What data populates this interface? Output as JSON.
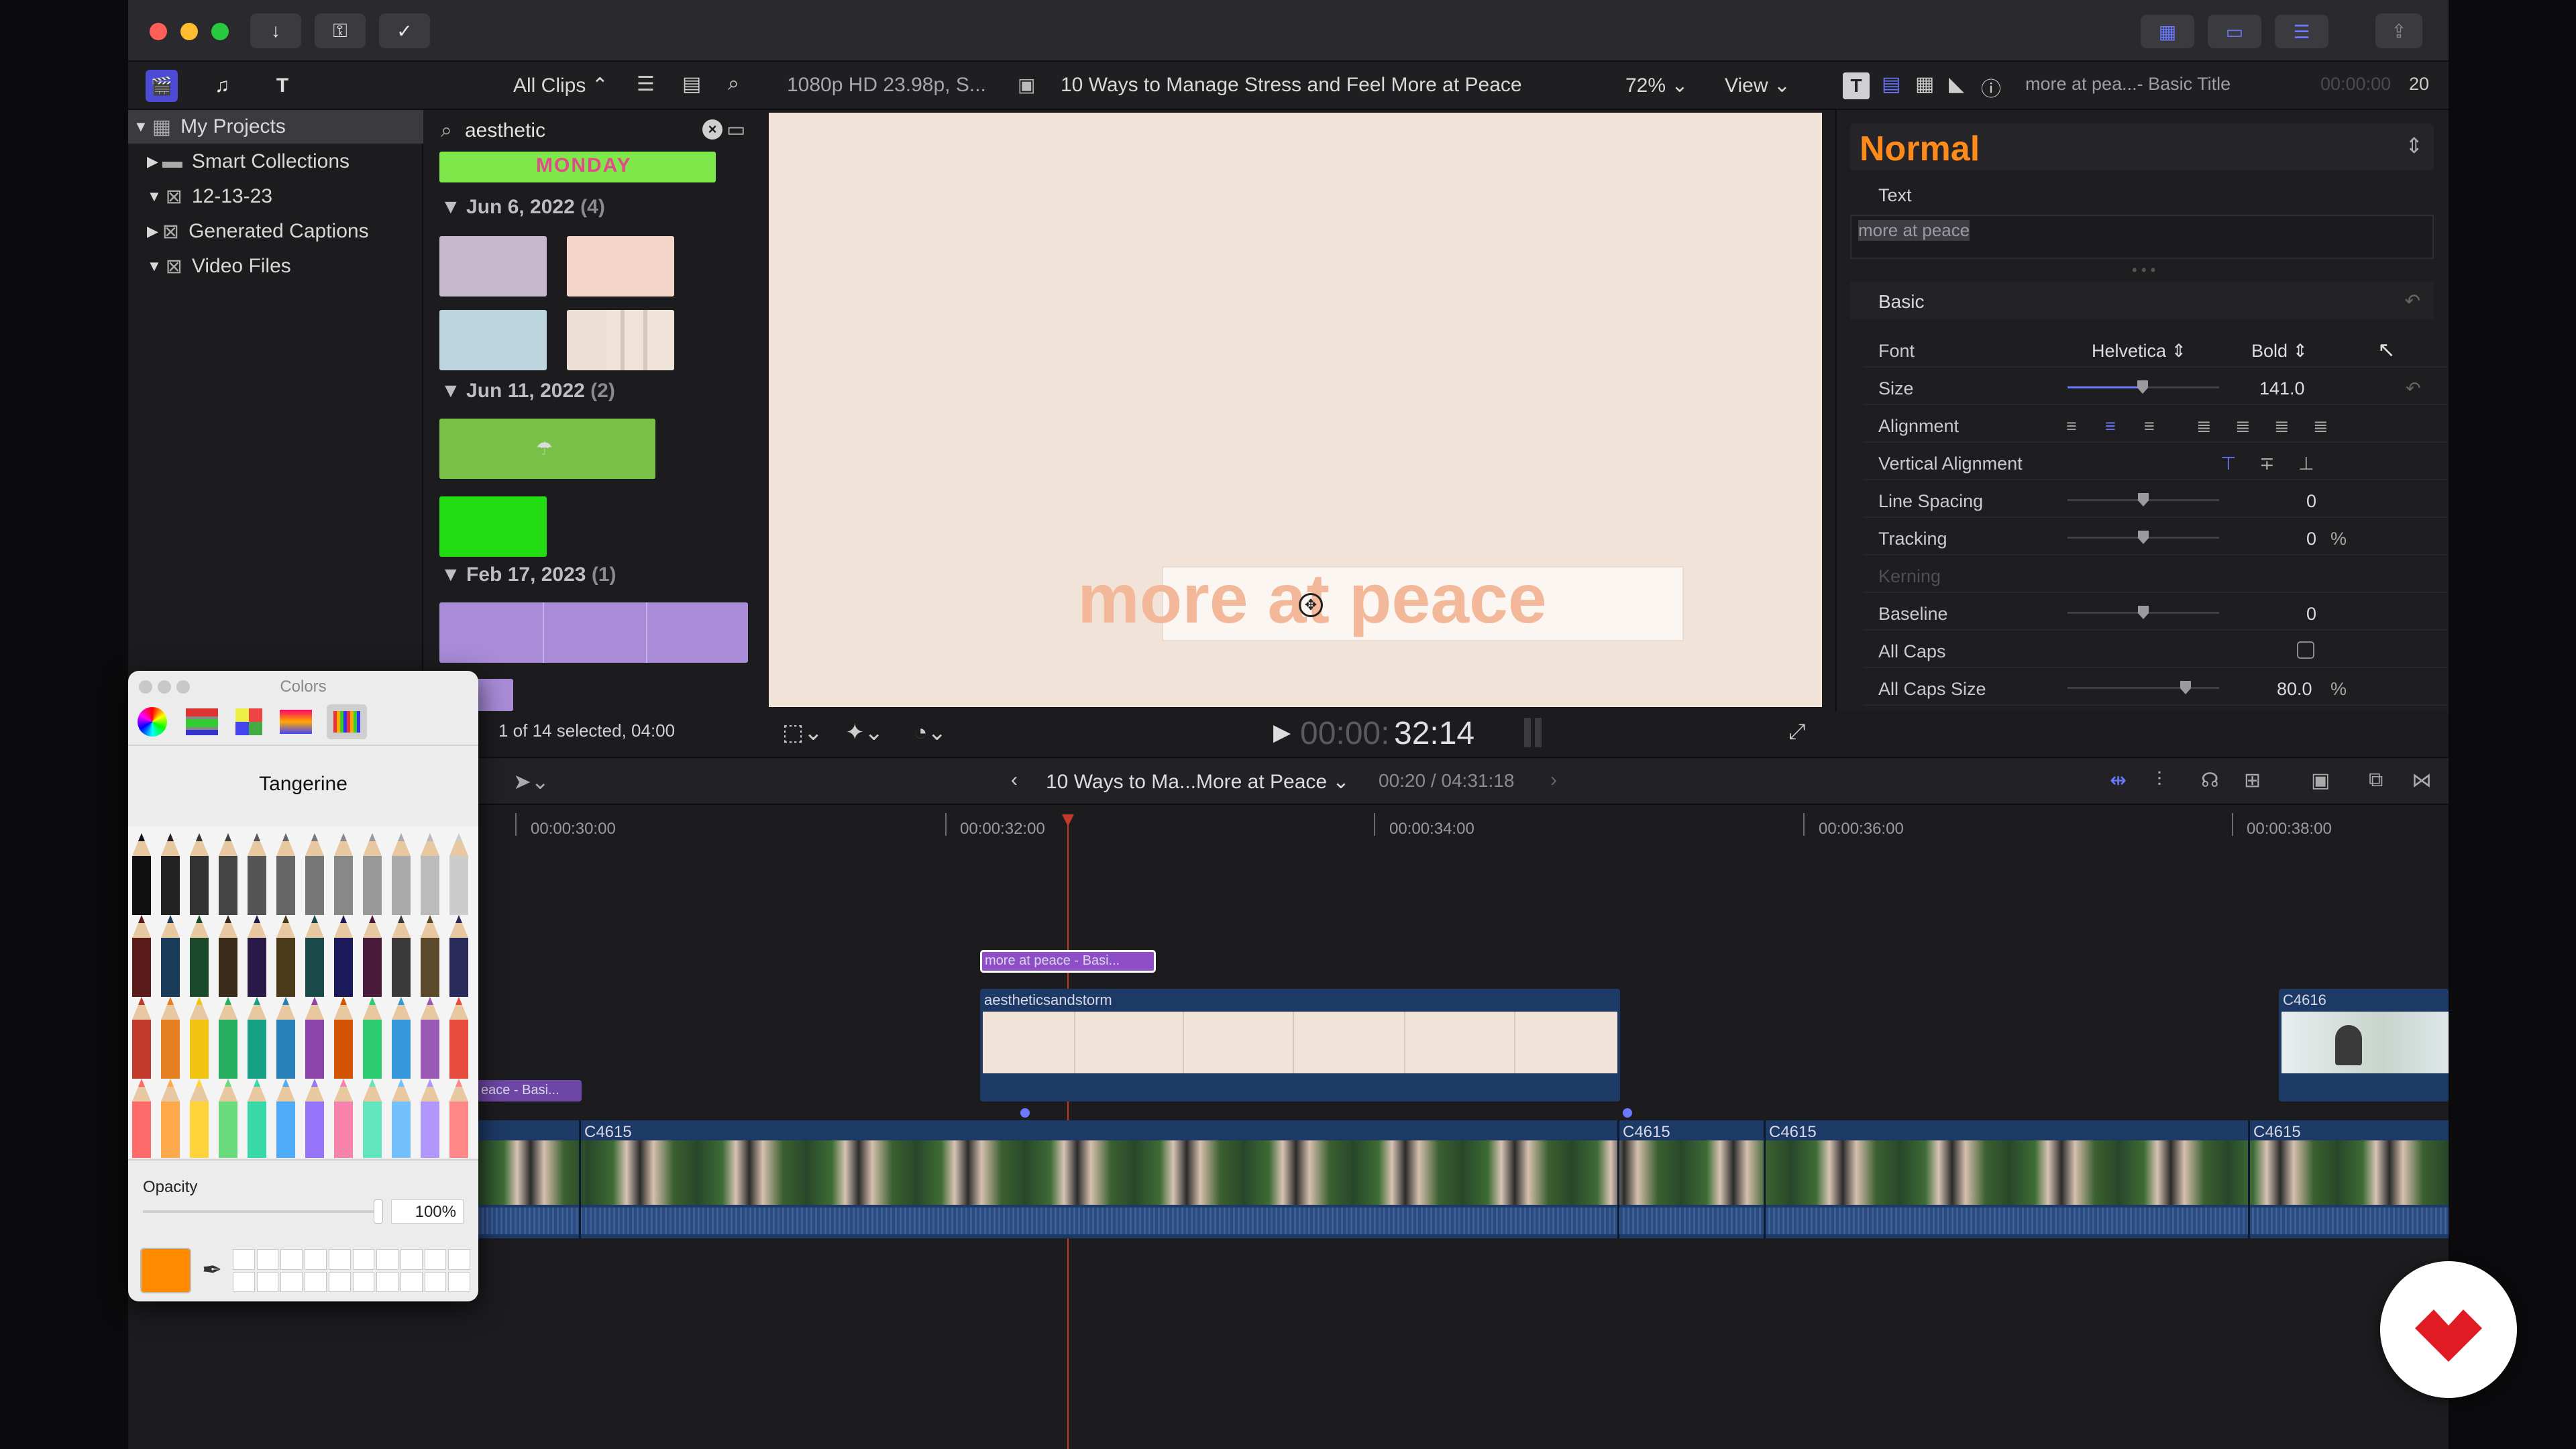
{
  "window": {
    "traffic_lights": [
      "close",
      "minimize",
      "zoom"
    ]
  },
  "toolbar": {
    "left_icons": [
      "download-icon",
      "key-icon",
      "checkmark-icon"
    ],
    "right_icons": [
      "grid-icon",
      "filmstrip-icon",
      "sliders-icon"
    ],
    "share_icon": "share-icon"
  },
  "libraries": {
    "filter_label": "All Clips",
    "items": [
      {
        "label": "My Projects",
        "expanded": true,
        "selected": true
      },
      {
        "label": "Smart Collections",
        "expanded": false
      },
      {
        "label": "12-13-23",
        "expanded": true
      },
      {
        "label": "Generated Captions",
        "expanded": false
      },
      {
        "label": "Video Files",
        "expanded": true
      }
    ]
  },
  "browser": {
    "search_value": "aesthetic",
    "groups": [
      {
        "date": "Jun 6, 2022",
        "count": "(4)"
      },
      {
        "date": "Jun 11, 2022",
        "count": "(2)"
      },
      {
        "date": "Feb 17, 2023",
        "count": "(1)"
      }
    ],
    "status": "1 of 14 selected, 04:00",
    "top_clip_text": "MONDAY"
  },
  "viewer": {
    "format": "1080p HD 23.98p, S...",
    "project_title": "10 Ways to Manage Stress and Feel More at Peace",
    "zoom": "72%",
    "view_label": "View",
    "title_text": "more at peace",
    "timecode_dim": "00:00:",
    "timecode": "32:14"
  },
  "inspector": {
    "clip_name": "more at pea...- Basic Title",
    "duration_dim": "00:00:00",
    "duration": "20",
    "preset": "Normal",
    "text_section": "Text",
    "text_value": "more at peace",
    "basic_section": "Basic",
    "rows": {
      "font": {
        "label": "Font",
        "value": "Helvetica",
        "weight": "Bold"
      },
      "size": {
        "label": "Size",
        "value": "141.0"
      },
      "alignment": {
        "label": "Alignment"
      },
      "vertical_alignment": {
        "label": "Vertical Alignment"
      },
      "line_spacing": {
        "label": "Line Spacing",
        "value": "0"
      },
      "tracking": {
        "label": "Tracking",
        "value": "0",
        "unit": "%"
      },
      "kerning": {
        "label": "Kerning"
      },
      "baseline": {
        "label": "Baseline",
        "value": "0"
      },
      "all_caps": {
        "label": "All Caps",
        "checked": false
      },
      "all_caps_size": {
        "label": "All Caps Size",
        "value": "80.0",
        "unit": "%"
      }
    },
    "accent_color": "#ff8a1c"
  },
  "timeline": {
    "project_name": "10 Ways to Ma...More at Peace",
    "position": "00:20 / 04:31:18",
    "ruler": [
      "00:00:30:00",
      "00:00:32:00",
      "00:00:34:00",
      "00:00:36:00",
      "00:00:38:00"
    ],
    "title_clip": "more at peace - Basi...",
    "title_clip_left": "eace - Basi...",
    "connected_clip": "aestheticsandstorm",
    "right_clip": "C4616",
    "primary_clips": [
      "C4615",
      "C4615",
      "C4615",
      "C4615"
    ]
  },
  "colors_panel": {
    "title": "Colors",
    "color_name": "Tangerine",
    "opacity_label": "Opacity",
    "opacity_value": "100%",
    "selected_color": "#ff8a00"
  }
}
